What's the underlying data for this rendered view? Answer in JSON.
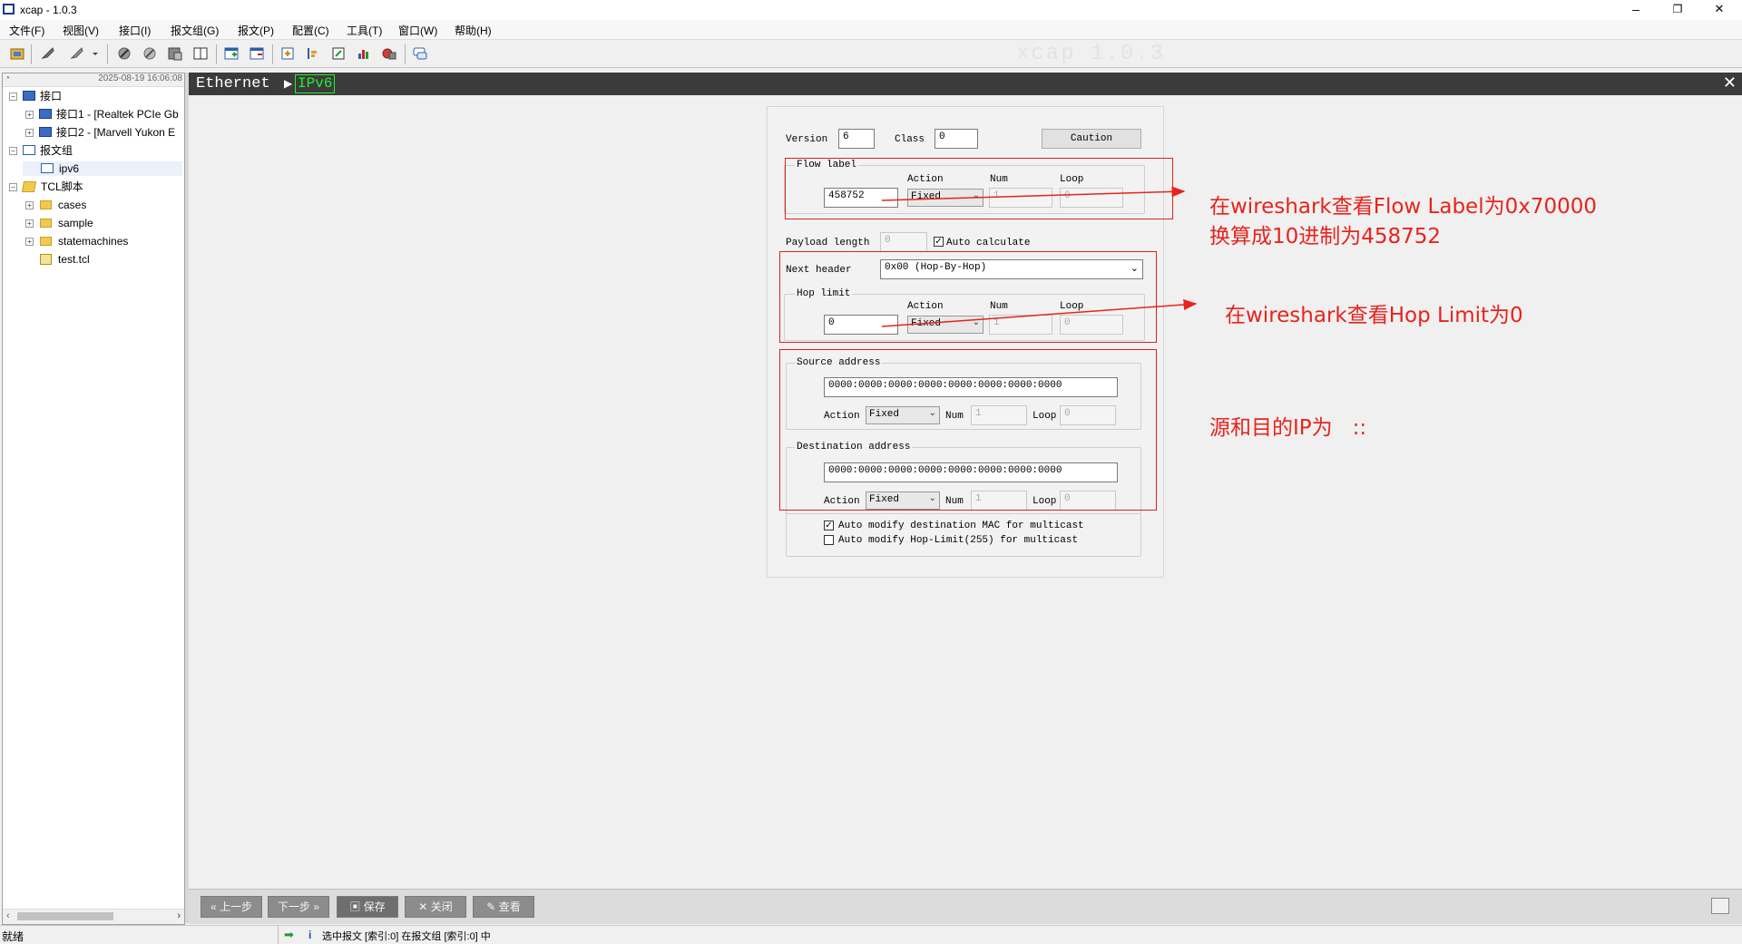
{
  "window": {
    "title": "xcap - 1.0.3",
    "watermark": "xcap 1.0.3",
    "min": "–",
    "restore": "❐",
    "close": "✕"
  },
  "menu": [
    "文件(F)",
    "视图(V)",
    "接口(I)",
    "报文组(G)",
    "报文(P)",
    "配置(C)",
    "工具(T)",
    "窗口(W)",
    "帮助(H)"
  ],
  "tree": {
    "timestamp": "2025-08-19 16:06:08",
    "nodes": [
      {
        "label": "接口"
      },
      {
        "label": "接口1 - [Realtek PCIe Gb"
      },
      {
        "label": "接口2 - [Marvell Yukon E"
      },
      {
        "label": "报文组"
      },
      {
        "label": "ipv6"
      },
      {
        "label": "TCL脚本"
      },
      {
        "label": "cases"
      },
      {
        "label": "sample"
      },
      {
        "label": "statemachines"
      },
      {
        "label": "test.tcl"
      }
    ]
  },
  "breadcrumb": {
    "root": "Ethernet",
    "current": "IPv6",
    "close": "✕"
  },
  "form": {
    "version_label": "Version",
    "version_value": "6",
    "class_label": "Class",
    "class_value": "0",
    "caution_label": "Caution",
    "flow_label_title": "Flow label",
    "action_label": "Action",
    "num_label": "Num",
    "loop_label": "Loop",
    "flow_value": "458752",
    "flow_action": "Fixed",
    "flow_num": "1",
    "flow_loop": "0",
    "payload_label": "Payload length",
    "payload_value": "0",
    "auto_calc_label": "Auto calculate",
    "auto_calc_checked": "✓",
    "next_header_label": "Next header",
    "next_header_value": "0x00 (Hop-By-Hop)",
    "hop_limit_title": "Hop limit",
    "hop_value": "0",
    "hop_action": "Fixed",
    "hop_num": "1",
    "hop_loop": "0",
    "src_title": "Source address",
    "src_value": "0000:0000:0000:0000:0000:0000:0000:0000",
    "src_action": "Fixed",
    "src_num": "1",
    "src_loop": "0",
    "dst_title": "Destination address",
    "dst_value": "0000:0000:0000:0000:0000:0000:0000:0000",
    "dst_action": "Fixed",
    "dst_num": "1",
    "dst_loop": "0",
    "auto_mac_label": "Auto modify destination MAC for multicast",
    "auto_mac_checked": "✓",
    "auto_hop_label": "Auto modify Hop-Limit(255) for multicast",
    "auto_hop_checked": ""
  },
  "annotations": {
    "flow_line1": "在wireshark查看Flow Label为0x70000",
    "flow_line2": "换算成10进制为458752",
    "hop": "在wireshark查看Hop Limit为0",
    "addr": "源和目的IP为   ::"
  },
  "bottom_buttons": {
    "prev": "上一步",
    "next": "下一步",
    "save": "保存",
    "close": "关闭",
    "view": "查看"
  },
  "status": {
    "left": "就绪",
    "message": "选中报文 [索引:0] 在报文组 [索引:0] 中"
  },
  "colors": {
    "annotation_red": "#e8231c",
    "breadcrumb_green": "#22ee33",
    "breadcrumb_bg": "#3b3b3b"
  }
}
